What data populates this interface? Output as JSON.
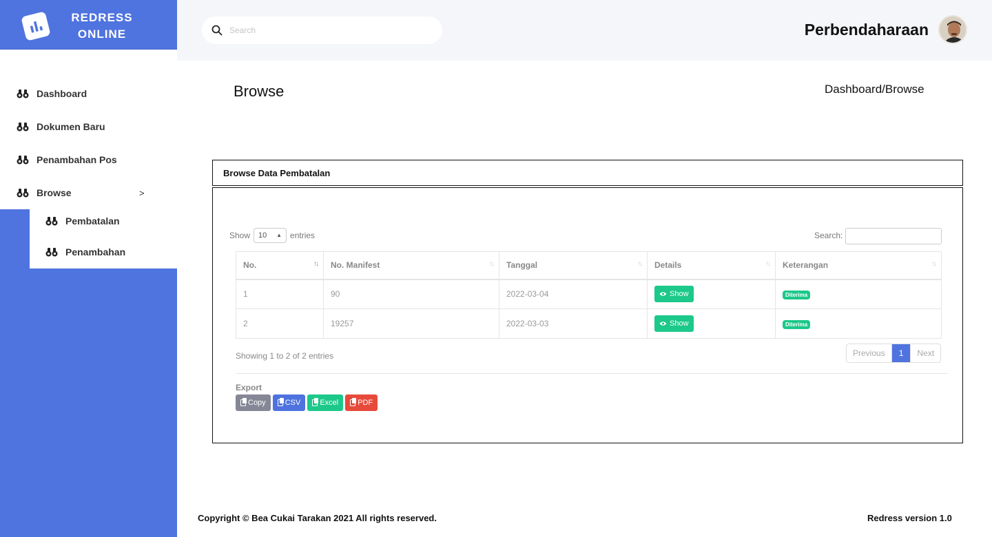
{
  "brand": {
    "line1": "REDRESS",
    "line2": "ONLINE",
    "logo_icon": "chart-bar-icon"
  },
  "sidebar": {
    "items": [
      {
        "label": "Dashboard",
        "icon": "binoculars-icon"
      },
      {
        "label": "Dokumen Baru",
        "icon": "binoculars-icon"
      },
      {
        "label": "Penambahan Pos",
        "icon": "binoculars-icon"
      },
      {
        "label": "Browse",
        "icon": "binoculars-icon",
        "caret": ">"
      }
    ],
    "subitems": [
      {
        "label": "Pembatalan",
        "icon": "binoculars-icon"
      },
      {
        "label": "Penambahan",
        "icon": "binoculars-icon"
      }
    ]
  },
  "topbar": {
    "search_placeholder": "Search",
    "user_name": "Perbendaharaan"
  },
  "page": {
    "title": "Browse",
    "breadcrumb": "Dashboard/Browse"
  },
  "card": {
    "title": "Browse Data Pembatalan",
    "show_label": "Show",
    "entries_value": "10",
    "entries_label": "entries",
    "search_label": "Search:",
    "columns": [
      "No.",
      "No. Manifest",
      "Tanggal",
      "Details",
      "Keterangan"
    ],
    "rows": [
      {
        "no": "1",
        "manifest": "90",
        "tanggal": "2022-03-04",
        "details": "Show",
        "keterangan": "Diterima"
      },
      {
        "no": "2",
        "manifest": "19257",
        "tanggal": "2022-03-03",
        "details": "Show",
        "keterangan": "Diterima"
      }
    ],
    "info": "Showing 1 to 2 of 2 entries",
    "pager": {
      "prev": "Previous",
      "page": "1",
      "next": "Next"
    },
    "export_label": "Export",
    "export_buttons": [
      {
        "label": "Copy",
        "color": "#858796"
      },
      {
        "label": "CSV",
        "color": "#4e73df"
      },
      {
        "label": "Excel",
        "color": "#1cc88a"
      },
      {
        "label": "PDF",
        "color": "#e74a3b"
      }
    ]
  },
  "footer": {
    "copyright": "Copyright © Bea Cukai Tarakan 2021 All rights reserved.",
    "version": "Redress version 1.0"
  },
  "colors": {
    "primary": "#4f73df",
    "success": "#1cc88a",
    "topbar_bg": "#f5f6fa"
  }
}
